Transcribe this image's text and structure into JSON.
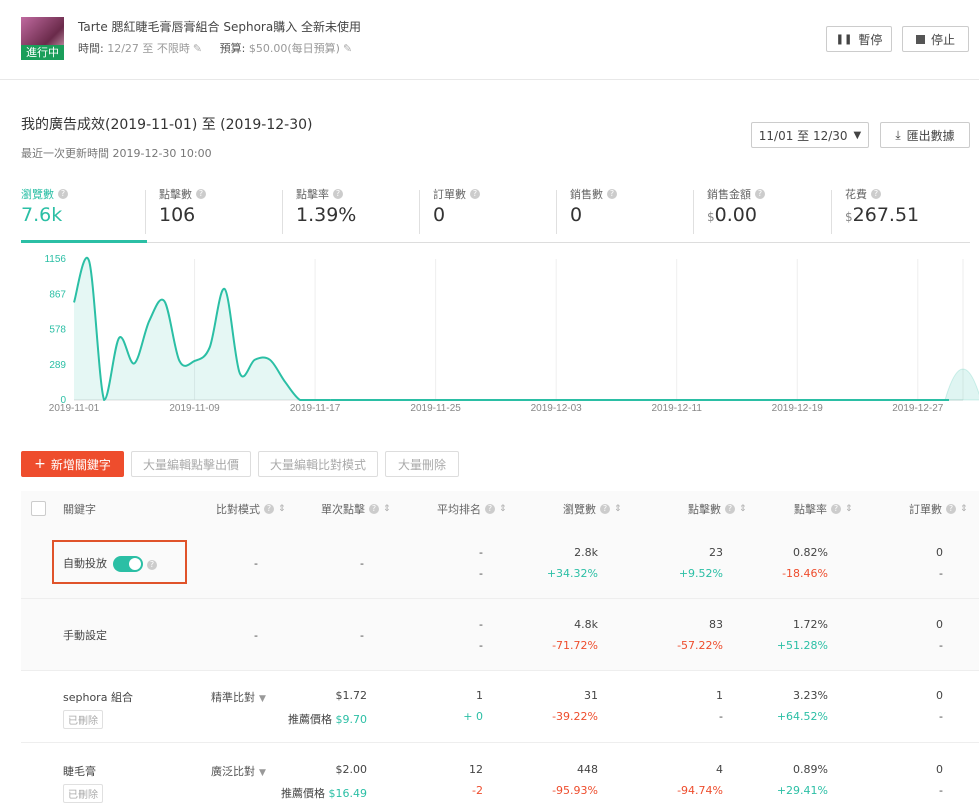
{
  "product": {
    "status_badge": "進行中",
    "title": "Tarte 腮紅睫毛膏唇膏組合 Sephora購入 全新未使用",
    "time_label": "時間:",
    "time_value": "12/27 至 不限時",
    "budget_label": "預算:",
    "budget_value": "$50.00(每日預算)"
  },
  "actions": {
    "pause": "暫停",
    "stop": "停止"
  },
  "performance": {
    "title": "我的廣告成效(2019-11-01) 至 (2019-12-30)",
    "updated": "最近一次更新時間 2019-12-30 10:00",
    "date_range": "11/01 至 12/30",
    "export": "匯出數據"
  },
  "metrics": [
    {
      "label": "瀏覽數",
      "value": "7.6k",
      "currency": ""
    },
    {
      "label": "點擊數",
      "value": "106",
      "currency": ""
    },
    {
      "label": "點擊率",
      "value": "1.39%",
      "currency": ""
    },
    {
      "label": "訂單數",
      "value": "0",
      "currency": ""
    },
    {
      "label": "銷售數",
      "value": "0",
      "currency": ""
    },
    {
      "label": "銷售金額",
      "value": "0.00",
      "currency": "$"
    },
    {
      "label": "花費",
      "value": "267.51",
      "currency": "$"
    }
  ],
  "chart_data": {
    "type": "area",
    "title": "",
    "xlabel": "",
    "ylabel": "",
    "y_ticks": [
      "1156",
      "867",
      "578",
      "289",
      "0"
    ],
    "ylim": [
      0,
      1156
    ],
    "x_ticks": [
      "2019-11-01",
      "2019-11-09",
      "2019-11-17",
      "2019-11-25",
      "2019-12-03",
      "2019-12-11",
      "2019-12-19",
      "2019-12-27"
    ],
    "grid": true,
    "series": [
      {
        "x": [
          "2019-11-01",
          "2019-11-02",
          "2019-11-03",
          "2019-11-04",
          "2019-11-05",
          "2019-11-06",
          "2019-11-07",
          "2019-11-08",
          "2019-11-09",
          "2019-11-10",
          "2019-11-11",
          "2019-11-12",
          "2019-11-13",
          "2019-11-14",
          "2019-11-15",
          "2019-11-16",
          "2019-11-17",
          "2019-11-18",
          "2019-12-30"
        ],
        "values": [
          800,
          1140,
          0,
          510,
          300,
          650,
          810,
          320,
          320,
          430,
          910,
          220,
          330,
          330,
          150,
          0,
          0,
          0,
          180
        ]
      }
    ],
    "color": "#2bbfa5"
  },
  "toolbar": {
    "add_keyword": "新增關鍵字",
    "bulk_bid": "大量編輯點擊出價",
    "bulk_match": "大量編輯比對模式",
    "bulk_delete": "大量刪除"
  },
  "table": {
    "headers": {
      "keyword": "關鍵字",
      "match": "比對模式",
      "bid": "單次點擊",
      "rank": "平均排名",
      "views": "瀏覽數",
      "clicks": "點擊數",
      "ctr": "點擊率",
      "orders": "訂單數"
    },
    "rows": [
      {
        "keyword": "自動投放",
        "match": "-",
        "bid": "-",
        "rank": "-",
        "rank_delta": "-",
        "views": "2.8k",
        "views_delta": "+34.32%",
        "clicks": "23",
        "clicks_delta": "+9.52%",
        "ctr": "0.82%",
        "ctr_delta": "-18.46%",
        "orders": "0",
        "orders_delta": "-"
      },
      {
        "keyword": "手動設定",
        "match": "-",
        "bid": "-",
        "rank": "-",
        "rank_delta": "-",
        "views": "4.8k",
        "views_delta": "-71.72%",
        "clicks": "83",
        "clicks_delta": "-57.22%",
        "ctr": "1.72%",
        "ctr_delta": "+51.28%",
        "orders": "0",
        "orders_delta": "-"
      },
      {
        "keyword": "sephora 組合",
        "deleted": "已刪除",
        "match": "精準比對",
        "bid": "$1.72",
        "suggest_label": "推薦價格",
        "suggest": "$9.70",
        "rank": "1",
        "rank_delta": "+ 0",
        "views": "31",
        "views_delta": "-39.22%",
        "clicks": "1",
        "clicks_delta": "-",
        "ctr": "3.23%",
        "ctr_delta": "+64.52%",
        "orders": "0",
        "orders_delta": "-"
      },
      {
        "keyword": "睫毛膏",
        "deleted": "已刪除",
        "match": "廣泛比對",
        "bid": "$2.00",
        "suggest_label": "推薦價格",
        "suggest": "$16.49",
        "rank": "12",
        "rank_delta": "-2",
        "views": "448",
        "views_delta": "-95.93%",
        "clicks": "4",
        "clicks_delta": "-94.74%",
        "ctr": "0.89%",
        "ctr_delta": "+29.41%",
        "orders": "0",
        "orders_delta": "-"
      }
    ]
  }
}
